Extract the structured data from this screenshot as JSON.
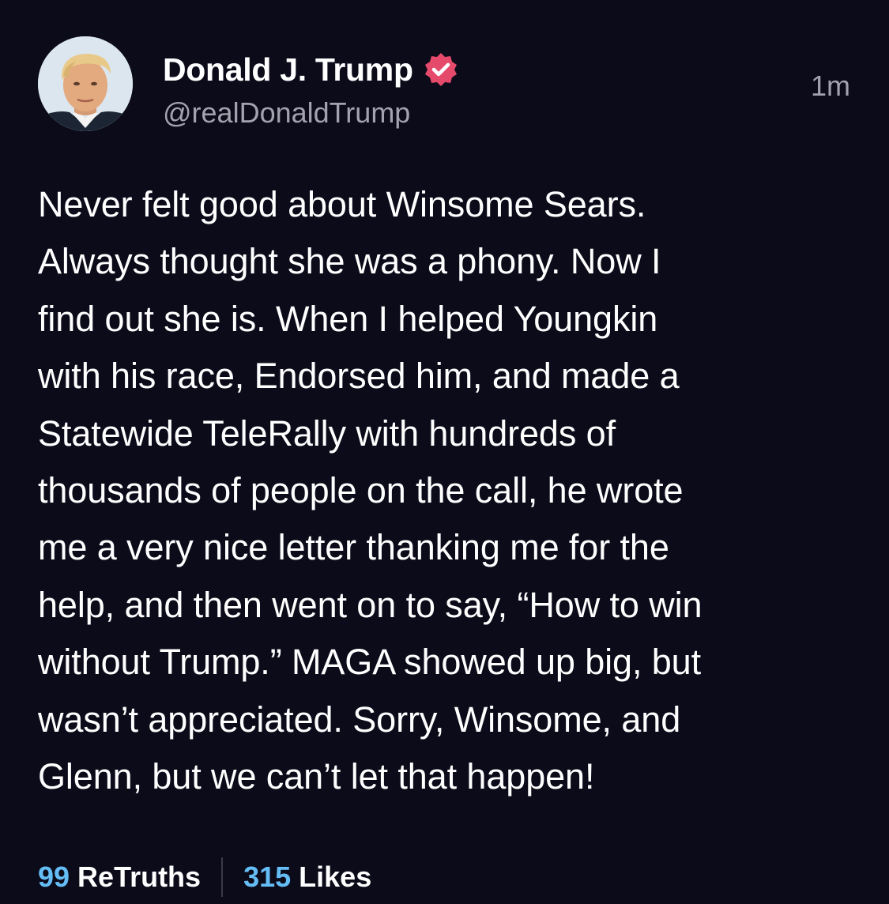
{
  "post": {
    "author": {
      "display_name": "Donald J. Trump",
      "handle": "@realDonaldTrump",
      "verified": true,
      "verified_badge_color": "#e64a6b"
    },
    "timestamp": "1m",
    "text": "Never felt good about Winsome Sears.\nAlways thought she was a phony. Now I\nfind out she is. When I helped Youngkin\nwith his race, Endorsed him, and made a\nStatewide TeleRally with hundreds of\nthousands of people on the call, he wrote\nme a very nice letter thanking me for the\nhelp, and then went on to say, “How to win\nwithout Trump.” MAGA showed up big, but\nwasn’t appreciated. Sorry, Winsome, and\nGlenn, but we can’t let that happen!",
    "stats": {
      "retruths_count": "99",
      "retruths_label": "ReTruths",
      "likes_count": "315",
      "likes_label": "Likes"
    }
  },
  "colors": {
    "background": "#0c0b1a",
    "text_primary": "#ffffff",
    "text_secondary": "#a3a3b0",
    "stat_count": "#65bdf6"
  }
}
